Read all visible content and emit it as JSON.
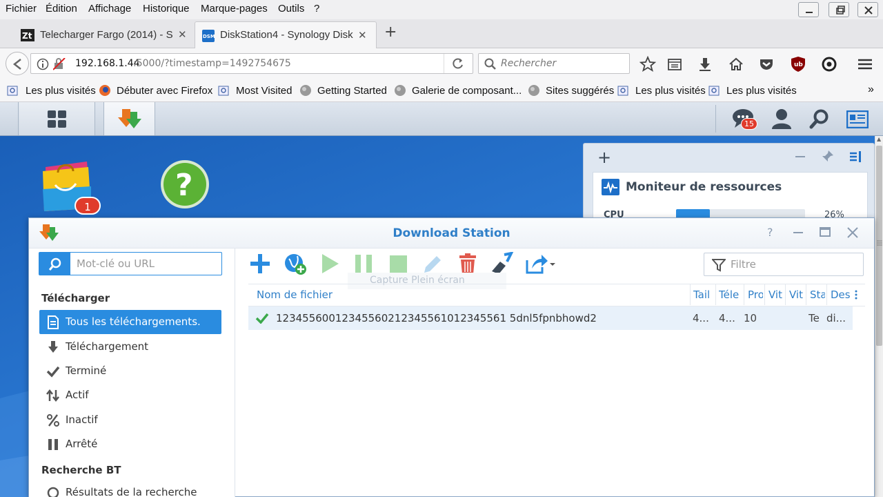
{
  "menubar": {
    "items": [
      "Fichier",
      "Édition",
      "Affichage",
      "Historique",
      "Marque-pages",
      "Outils",
      "?"
    ]
  },
  "tabs": [
    {
      "title": "Telecharger Fargo (2014) - S",
      "icon": "zt-favicon-icon"
    },
    {
      "title": "DiskStation4 - Synology Disk",
      "icon": "dsm-favicon-icon",
      "active": true
    }
  ],
  "navbar": {
    "url_host": "192.168.1.44",
    "url_rest": ":5000/?timestamp=1492754675",
    "search_placeholder": "Rechercher"
  },
  "bookmarks": [
    "Les plus visités",
    "Débuter avec Firefox",
    "Most Visited",
    "Getting Started",
    "Galerie de composant...",
    "Sites suggérés",
    "Les plus visités",
    "Les plus visités"
  ],
  "dsm": {
    "notification_count": "15",
    "desktop_badge": "1"
  },
  "widget": {
    "title": "Moniteur de ressources",
    "cpu_label": "CPU",
    "cpu_value": "26%",
    "cpu_fraction": 0.26
  },
  "download_station": {
    "title": "Download Station",
    "search_placeholder": "Mot-clé ou URL",
    "filter_placeholder": "Filtre",
    "tooltip": "Capture Plein écran",
    "sections": {
      "download": "Télécharger",
      "bt": "Recherche BT"
    },
    "sidebar_items": [
      {
        "label": "Tous les téléchargements.",
        "icon": "list-icon",
        "active": true
      },
      {
        "label": "Téléchargement",
        "icon": "download-arrow-icon"
      },
      {
        "label": "Terminé",
        "icon": "check-icon"
      },
      {
        "label": "Actif",
        "icon": "up-down-arrows-icon"
      },
      {
        "label": "Inactif",
        "icon": "percent-icon"
      },
      {
        "label": "Arrêté",
        "icon": "pause-icon"
      }
    ],
    "bt_item": "Résultats de la recherche",
    "columns": [
      "Nom de fichier",
      "Tail",
      "Téle",
      "Pro",
      "Vit",
      "Vit",
      "Sta",
      "Des"
    ],
    "rows": [
      {
        "name": "12345560012345560212345561012345561 5dnl5fpnbhowd2",
        "cells": [
          "4...",
          "4...",
          "10",
          "",
          "",
          "Te",
          "di..."
        ]
      }
    ]
  }
}
